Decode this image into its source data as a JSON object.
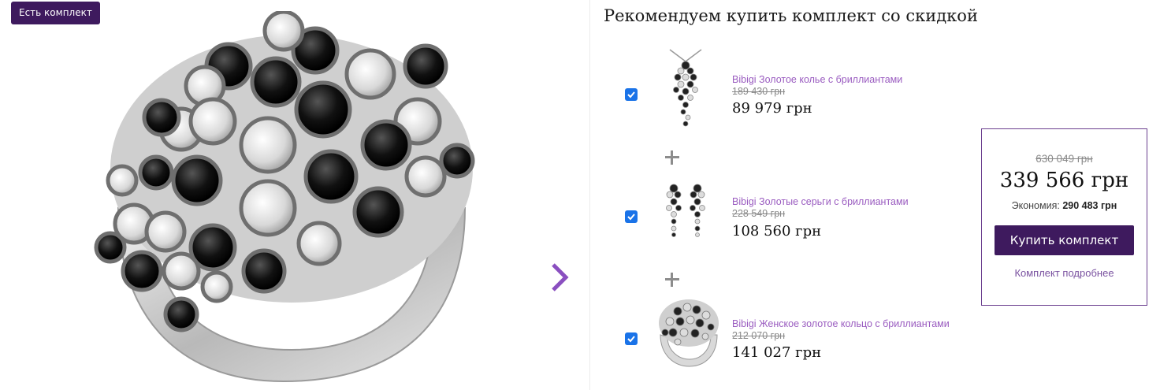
{
  "gallery": {
    "badge": "Есть комплект",
    "image_alt": "ring-with-black-and-white-diamonds",
    "next_icon": "chevron-right-icon"
  },
  "recommend": {
    "title": "Рекомендуем купить комплект со скидкой",
    "items": [
      {
        "name": "Bibigi Золотое колье с бриллиантами",
        "old_price": "189 430 грн",
        "price": "89 979 грн",
        "checked": true,
        "thumb": "necklace"
      },
      {
        "name": "Bibigi Золотые серьги с бриллиантами",
        "old_price": "228 549 грн",
        "price": "108 560 грн",
        "checked": true,
        "thumb": "earrings"
      },
      {
        "name": "Bibigi Женское золотое кольцо с бриллиантами",
        "old_price": "212 070 грн",
        "price": "141 027 грн",
        "checked": true,
        "thumb": "ring"
      }
    ]
  },
  "summary": {
    "old_total": "630 049 грн",
    "total": "339 566 грн",
    "savings_label": "Экономия:",
    "savings_value": "290 483 грн",
    "buy_label": "Купить комплект",
    "more_label": "Комплект подробнее"
  },
  "colors": {
    "accent": "#3e1a5e",
    "link": "#9a5cc0",
    "checkbox": "#1a73e8",
    "summary_border": "#6b3f8f"
  }
}
